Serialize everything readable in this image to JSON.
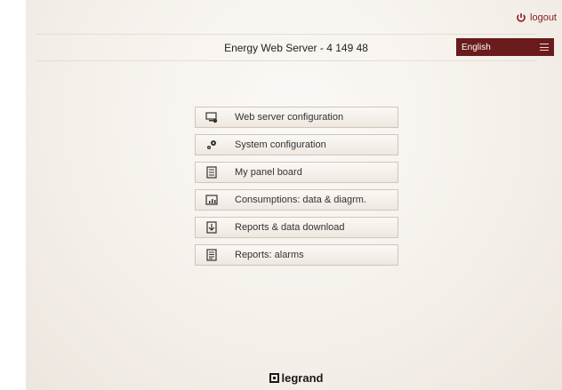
{
  "header": {
    "logout_label": "logout",
    "title": "Energy Web Server - 4 149 48",
    "language": "English"
  },
  "menu": [
    {
      "label": "Web server configuration",
      "icon": "monitor-settings-icon"
    },
    {
      "label": "System configuration",
      "icon": "gears-icon"
    },
    {
      "label": "My panel board",
      "icon": "panel-board-icon"
    },
    {
      "label": "Consumptions: data & diagrm.",
      "icon": "chart-icon"
    },
    {
      "label": "Reports & data download",
      "icon": "report-download-icon"
    },
    {
      "label": "Reports: alarms",
      "icon": "alarm-report-icon"
    }
  ],
  "footer": {
    "brand": "legrand"
  },
  "colors": {
    "accent": "#6a1b1b",
    "logout": "#8b1a1a"
  }
}
